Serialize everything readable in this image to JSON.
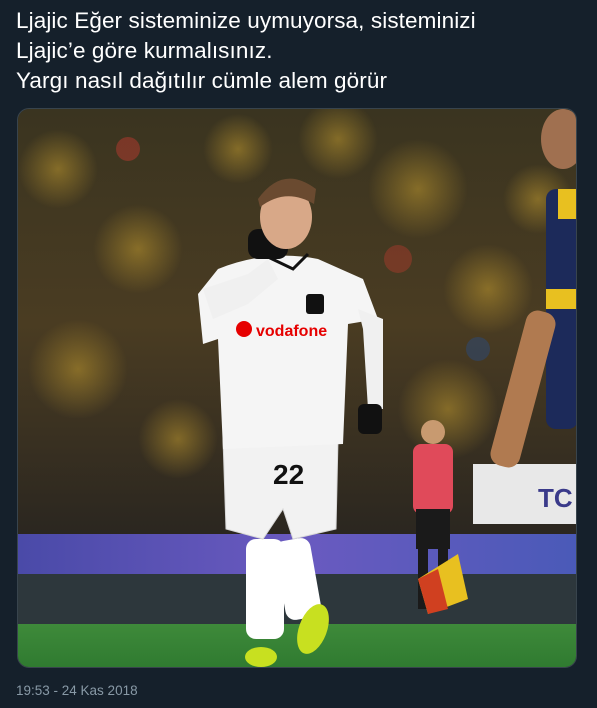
{
  "tweet": {
    "lines": [
      "Ljajic Eğer sisteminize uymuyorsa, sisteminizi",
      "Ljajic’e göre kurmalısınız.",
      "Yargı nasıl dağıtılır cümle alem görür"
    ],
    "timestamp": "19:53 - 24 Kas 2018"
  },
  "photo": {
    "sponsor": "vodafone",
    "jersey_number": "22",
    "banner_text": "TC"
  },
  "colors": {
    "background": "#15202b",
    "text": "#ffffff",
    "muted": "#8899a6",
    "border": "#38444d"
  }
}
